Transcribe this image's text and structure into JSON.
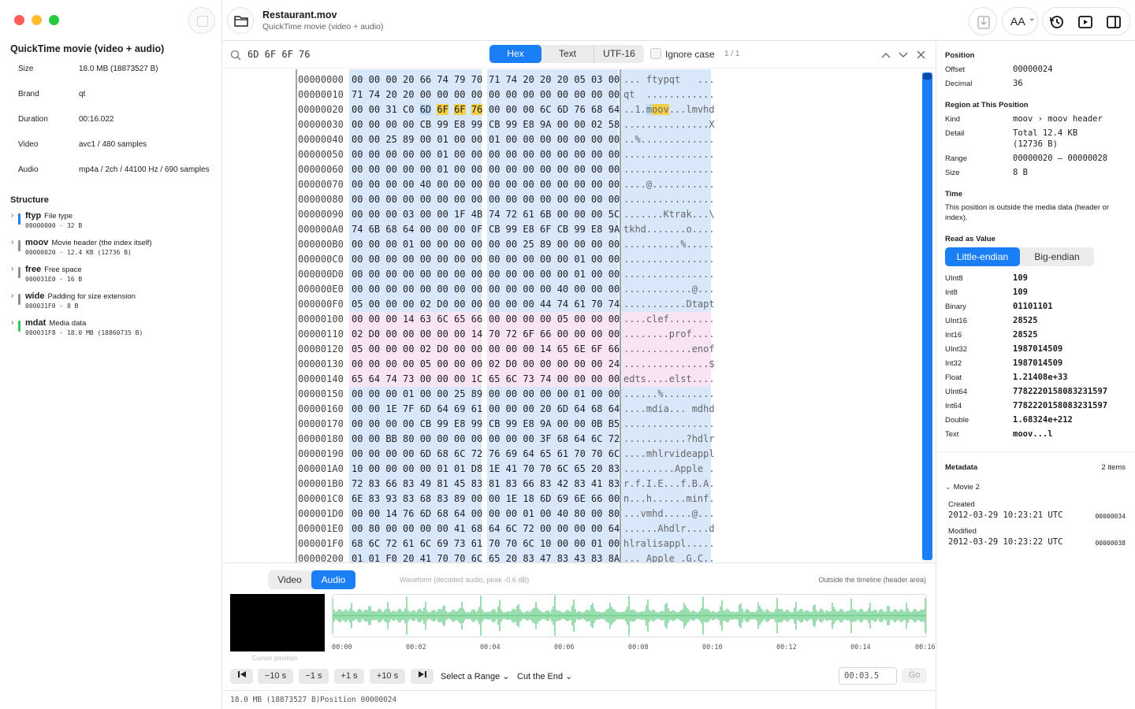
{
  "sidebar": {
    "kind": "QuickTime movie (video + audio)",
    "meta": [
      {
        "label": "Size",
        "value": "18.0 MB (18873527 B)"
      },
      {
        "label": "Brand",
        "value": "qt"
      },
      {
        "label": "Duration",
        "value": "00:16.022"
      },
      {
        "label": "Video",
        "value": "avc1 / 480 samples"
      },
      {
        "label": "Audio",
        "value": "mp4a / 2ch / 44100 Hz / 690 samples"
      }
    ],
    "structure_title": "Structure",
    "atoms": [
      {
        "name": "ftyp",
        "desc": "File type",
        "sub": "00000000 · 32 B",
        "color": "#1a7ef5"
      },
      {
        "name": "moov",
        "desc": "Movie header (the index itself)",
        "sub": "00000020 · 12.4 KB (12736 B)",
        "color": "#8e8e93"
      },
      {
        "name": "free",
        "desc": "Free space",
        "sub": "000031E0 · 16 B",
        "color": "#8e8e93"
      },
      {
        "name": "wide",
        "desc": "Padding for size extension",
        "sub": "000031F0 · 8 B",
        "color": "#8e8e93"
      },
      {
        "name": "mdat",
        "desc": "Media data",
        "sub": "000031F8 · 18.0 MB (18860735 B)",
        "color": "#34c759"
      }
    ]
  },
  "header": {
    "title": "Restaurant.mov",
    "subtitle": "QuickTime movie (video + audio)",
    "font_button": "AA"
  },
  "search": {
    "query": "6D 6F 6F 76",
    "modes": [
      "Hex",
      "Text",
      "UTF-16"
    ],
    "active_mode": "Hex",
    "ignore_case": "Ignore case",
    "match_count": "1 / 1"
  },
  "hex": {
    "rows": [
      {
        "a": "00000000",
        "h1": "00 00 00 20 66 74 79 70",
        "h2": "71 74 20 20 20 05 03 00",
        "t": "... ftypqt   ..."
      },
      {
        "a": "00000010",
        "h1": "71 74 20 20 00 00 00 00",
        "h2": "00 00 00 00 00 00 00 00",
        "t": "qt  ............"
      },
      {
        "a": "00000020",
        "h1": "00 00 31 C0 6D 6F 6F 76",
        "h2": "00 00 00 6C 6D 76 68 64",
        "t": "..1.moov...lmvhd"
      },
      {
        "a": "00000030",
        "h1": "00 00 00 00 CB 99 E8 99",
        "h2": "CB 99 E8 9A 00 00 02 58",
        "t": "...............X"
      },
      {
        "a": "00000040",
        "h1": "00 00 25 89 00 01 00 00",
        "h2": "01 00 00 00 00 00 00 00",
        "t": "..%............."
      },
      {
        "a": "00000050",
        "h1": "00 00 00 00 00 01 00 00",
        "h2": "00 00 00 00 00 00 00 00",
        "t": "................"
      },
      {
        "a": "00000060",
        "h1": "00 00 00 00 00 01 00 00",
        "h2": "00 00 00 00 00 00 00 00",
        "t": "................"
      },
      {
        "a": "00000070",
        "h1": "00 00 00 00 40 00 00 00",
        "h2": "00 00 00 00 00 00 00 00",
        "t": "....@..........."
      },
      {
        "a": "00000080",
        "h1": "00 00 00 00 00 00 00 00",
        "h2": "00 00 00 00 00 00 00 00",
        "t": "................"
      },
      {
        "a": "00000090",
        "h1": "00 00 00 03 00 00 1F 4B",
        "h2": "74 72 61 6B 00 00 00 5C",
        "t": ".......Ktrak...\\"
      },
      {
        "a": "000000A0",
        "h1": "74 6B 68 64 00 00 00 0F",
        "h2": "CB 99 E8 6F CB 99 E8 9A",
        "t": "tkhd.......o...."
      },
      {
        "a": "000000B0",
        "h1": "00 00 00 01 00 00 00 00",
        "h2": "00 00 25 89 00 00 00 00",
        "t": "..........%....."
      },
      {
        "a": "000000C0",
        "h1": "00 00 00 00 00 00 00 00",
        "h2": "00 00 00 00 00 01 00 00",
        "t": "................"
      },
      {
        "a": "000000D0",
        "h1": "00 00 00 00 00 00 00 00",
        "h2": "00 00 00 00 00 01 00 00",
        "t": "................"
      },
      {
        "a": "000000E0",
        "h1": "00 00 00 00 00 00 00 00",
        "h2": "00 00 00 00 40 00 00 00",
        "t": "............@..."
      },
      {
        "a": "000000F0",
        "h1": "05 00 00 00 02 D0 00 00",
        "h2": "00 00 00 44 74 61 70 74",
        "t": "...........Dtapt"
      },
      {
        "a": "00000100",
        "h1": "00 00 00 14 63 6C 65 66",
        "h2": "00 00 00 00 05 00 00 00",
        "t": "....clef........"
      },
      {
        "a": "00000110",
        "h1": "02 D0 00 00 00 00 00 14",
        "h2": "70 72 6F 66 00 00 00 00",
        "t": "........prof...."
      },
      {
        "a": "00000120",
        "h1": "05 00 00 00 02 D0 00 00",
        "h2": "00 00 00 14 65 6E 6F 66",
        "t": "............enof"
      },
      {
        "a": "00000130",
        "h1": "00 00 00 00 05 00 00 00",
        "h2": "02 D0 00 00 00 00 00 24",
        "t": "...............$"
      },
      {
        "a": "00000140",
        "h1": "65 64 74 73 00 00 00 1C",
        "h2": "65 6C 73 74 00 00 00 00",
        "t": "edts....elst...."
      },
      {
        "a": "00000150",
        "h1": "00 00 00 01 00 00 25 89",
        "h2": "00 00 00 00 00 01 00 00",
        "t": "......%........."
      },
      {
        "a": "00000160",
        "h1": "00 00 1E 7F 6D 64 69 61",
        "h2": "00 00 00 20 6D 64 68 64",
        "t": "....mdia... mdhd"
      },
      {
        "a": "00000170",
        "h1": "00 00 00 00 CB 99 E8 99",
        "h2": "CB 99 E8 9A 00 00 0B B5",
        "t": "................"
      },
      {
        "a": "00000180",
        "h1": "00 00 BB 80 00 00 00 00",
        "h2": "00 00 00 3F 68 64 6C 72",
        "t": "...........?hdlr"
      },
      {
        "a": "00000190",
        "h1": "00 00 00 00 6D 68 6C 72",
        "h2": "76 69 64 65 61 70 70 6C",
        "t": "....mhlrvideappl"
      },
      {
        "a": "000001A0",
        "h1": "10 00 00 00 00 01 01 D8",
        "h2": "1E 41 70 70 6C 65 20 83",
        "t": ".........Apple ."
      },
      {
        "a": "000001B0",
        "h1": "72 83 66 83 49 81 45 83",
        "h2": "81 83 66 83 42 83 41 83",
        "t": "r.f.I.E...f.B.A."
      },
      {
        "a": "000001C0",
        "h1": "6E 83 93 83 68 83 89 00",
        "h2": "00 1E 18 6D 69 6E 66 00",
        "t": "n...h......minf."
      },
      {
        "a": "000001D0",
        "h1": "00 00 14 76 6D 68 64 00",
        "h2": "00 00 01 00 40 80 00 80",
        "t": "...vmhd.....@..."
      },
      {
        "a": "000001E0",
        "h1": "00 80 00 00 00 00 41 68",
        "h2": "64 6C 72 00 00 00 00 64",
        "t": "......Ahdlr....d"
      },
      {
        "a": "000001F0",
        "h1": "68 6C 72 61 6C 69 73 61",
        "h2": "70 70 6C 10 00 00 01 00",
        "t": "hlralisappl....."
      },
      {
        "a": "00000200",
        "h1": "01 01 F0 20 41 70 70 6C",
        "h2": "65 20 83 47 83 43 83 8A",
        "t": "... Apple .G.C.."
      }
    ]
  },
  "timeline": {
    "tabs": [
      "Video",
      "Audio"
    ],
    "active_tab": "Audio",
    "waveform_label": "Waveform (decoded audio, peak -0.6 dB)",
    "outside_label": "Outside the timeline (header area)",
    "cursor_label": "Cursor position",
    "ticks": [
      "00:00",
      "00:02",
      "00:04",
      "00:06",
      "00:08",
      "00:10",
      "00:12",
      "00:14",
      "00:16"
    ],
    "buttons": [
      "−10 s",
      "−1 s",
      "+1 s",
      "+10 s"
    ],
    "select_range": "Select a Range",
    "cut_end": "Cut the End",
    "time_value": "00:03.5",
    "go": "Go"
  },
  "status": {
    "size": "18.0 MB (18873527 B)",
    "position": "Position 00000024"
  },
  "inspector": {
    "position_title": "Position",
    "offset_label": "Offset",
    "offset": "00000024",
    "decimal_label": "Decimal",
    "decimal": "36",
    "region_title": "Region at This Position",
    "kind_label": "Kind",
    "kind": "moov › moov header",
    "detail_label": "Detail",
    "detail1": "Total 12.4 KB",
    "detail2": "(12736 B)",
    "range_label": "Range",
    "range": "00000020 – 00000028",
    "size_label": "Size",
    "size": "8 B",
    "time_title": "Time",
    "time_text": "This position is outside the media data (header or index).",
    "value_title": "Read as Value",
    "endian": [
      "Little-endian",
      "Big-endian"
    ],
    "values": [
      {
        "label": "UInt8",
        "value": "109"
      },
      {
        "label": "Int8",
        "value": "109"
      },
      {
        "label": "Binary",
        "value": "01101101"
      },
      {
        "label": "UInt16",
        "value": "28525"
      },
      {
        "label": "Int16",
        "value": "28525"
      },
      {
        "label": "UInt32",
        "value": "1987014509"
      },
      {
        "label": "Int32",
        "value": "1987014509"
      },
      {
        "label": "Float",
        "value": "1.21408e+33"
      },
      {
        "label": "UInt64",
        "value": "7782220158083231597"
      },
      {
        "label": "Int64",
        "value": "7782220158083231597"
      },
      {
        "label": "Double",
        "value": "1.68324e+212"
      },
      {
        "label": "Text",
        "value": "moov...l"
      }
    ],
    "metadata_title": "Metadata",
    "metadata_count": "2 items",
    "movie_group": "Movie  2",
    "created_label": "Created",
    "created": "2012-03-29 10:23:21 UTC",
    "created_off": "00000034",
    "modified_label": "Modified",
    "modified": "2012-03-29 10:23:22 UTC",
    "modified_off": "00000038"
  },
  "colors": {
    "accent": "#1a7ef5",
    "match": "#f4cf4a",
    "hexbg": "#d8e8fa",
    "pink": "#f9e4f5",
    "wave": "#6fcf8e"
  }
}
